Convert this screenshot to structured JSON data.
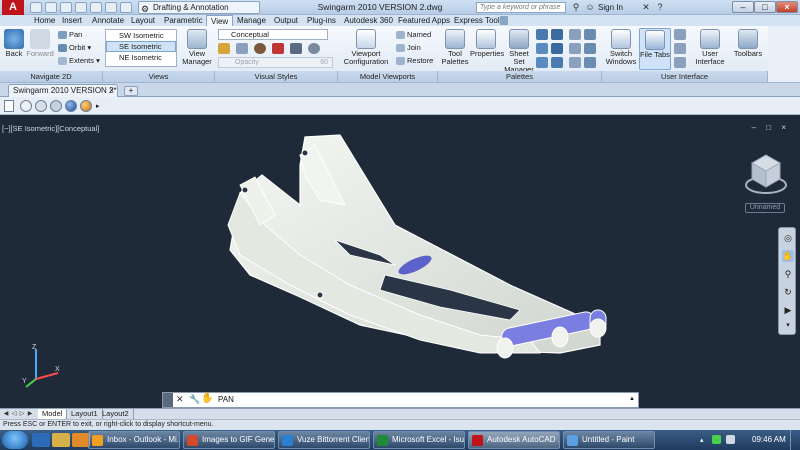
{
  "titlebar": {
    "app_logo": "A",
    "workspace": "Drafting & Annotation",
    "doc_title": "Swingarm 2010 VERSION 2.dwg",
    "search_placeholder": "Type a keyword or phrase",
    "signin": "Sign In"
  },
  "ribbon_tabs": [
    "Home",
    "Insert",
    "Annotate",
    "Layout",
    "Parametric",
    "View",
    "Manage",
    "Output",
    "Plug-ins",
    "Autodesk 360",
    "Featured Apps",
    "Express Tools"
  ],
  "active_tab": "View",
  "ribbon": {
    "navigate": {
      "title": "Navigate 2D",
      "back": "Back",
      "forward": "Forward",
      "pan": "Pan",
      "orbit": "Orbit",
      "extents": "Extents"
    },
    "views": {
      "title": "Views",
      "items": [
        "SW Isometric",
        "SE Isometric",
        "NE Isometric"
      ],
      "selected": "SE Isometric",
      "view_manager": "View Manager"
    },
    "visual_styles": {
      "title": "Visual Styles",
      "style": "Conceptual",
      "opacity_label": "Opacity",
      "opacity_value": "60"
    },
    "model_viewports": {
      "title": "Model Viewports",
      "viewport_config": "Viewport Configuration",
      "named": "Named",
      "join": "Join",
      "restore": "Restore"
    },
    "palettes": {
      "title": "Palettes",
      "tool_palettes": "Tool Palettes",
      "properties": "Properties",
      "sheet_set": "Sheet Set Manager"
    },
    "user_interface": {
      "title": "User Interface",
      "switch_windows": "Switch Windows",
      "file_tabs": "File Tabs",
      "user_interface": "User Interface",
      "toolbars": "Toolbars"
    }
  },
  "doc_tab": {
    "label": "Swingarm 2010 VERSION 2*",
    "close": "×",
    "new": "+"
  },
  "viewport": {
    "label": "[−][SE Isometric][Conceptual]",
    "controls": "– □ ×",
    "ucs_name": "Unnamed",
    "ucs_x": "X",
    "ucs_y": "Y",
    "ucs_z": "Z"
  },
  "command": {
    "text": "PAN",
    "close": "✕",
    "wrench": "🔧",
    "hand": "✋",
    "arrow": "▲"
  },
  "layout_tabs": [
    "Model",
    "Layout1",
    "Layout2"
  ],
  "status": "Press ESC or ENTER to exit, or right-click to display shortcut-menu.",
  "taskbar": {
    "tasks": [
      {
        "label": "Inbox - Outlook - Mi...",
        "color": "#f0a020"
      },
      {
        "label": "Images to GIF Gener...",
        "color": "#d24a2a"
      },
      {
        "label": "Vuze Bittorrent Client",
        "color": "#2a7fd0"
      },
      {
        "label": "Microsoft Excel - Isuz...",
        "color": "#1f8a3a"
      },
      {
        "label": "Autodesk AutoCAD ...",
        "color": "#c0131a"
      },
      {
        "label": "Untitled - Paint",
        "color": "#5aa0e0"
      }
    ],
    "clock": "09:46 AM"
  },
  "colors": {
    "accent": "#c0131a",
    "viewport_bg": "#1f2a38",
    "ribbon_bg": "#e8eff8"
  }
}
